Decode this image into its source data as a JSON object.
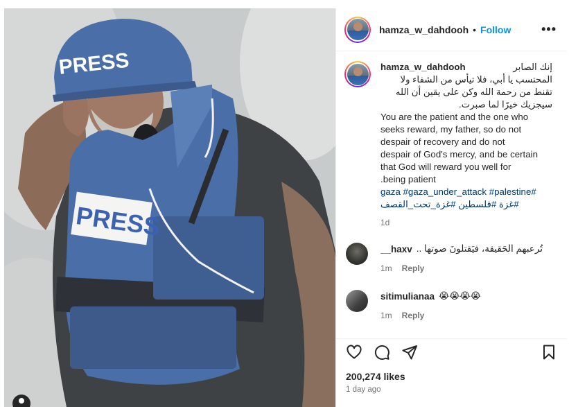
{
  "post": {
    "username": "hamza_w_dahdooh",
    "separator": "•",
    "follow_label": "Follow",
    "more_label": "•••",
    "photo": {
      "helmet_text": "PRESS",
      "vest_text": "PRESS"
    }
  },
  "caption": {
    "username": "hamza_w_dahdooh",
    "arabic_first": "إنك الصابر",
    "arabic_lines": [
      "المحتسب يا أبي، فلا تيأس من الشفاء ولا",
      "تقنط من رحمة الله وكن على يقين أن الله",
      "سيجزيك خيرًا لما صبرت."
    ],
    "english_lines": [
      "You are the patient and the one who",
      "seeks reward, my father, so do not",
      "despair of recovery and do not",
      "despair of God's mercy, and be certain",
      "that God will reward you well for",
      ".being patient"
    ],
    "hashtags_line1": "gaza #gaza_under_attack #palestine#",
    "hashtags_line2": "#غزة #فلسطين #غزة_تحت_القصف",
    "age": "1d"
  },
  "comments": [
    {
      "username": "__haxv",
      "text": "تُرعبهم الحَقيقة، فيَقتلونَ صوتها ..",
      "age": "1m",
      "reply_label": "Reply"
    },
    {
      "username": "sitimulianaa",
      "text": "😭😭😭😭",
      "age": "1m",
      "reply_label": "Reply"
    }
  ],
  "actions": {
    "icons": [
      "heart-icon",
      "comment-icon",
      "share-icon",
      "bookmark-icon"
    ],
    "likes": "200,274 likes",
    "posted": "1 day ago"
  },
  "colors": {
    "accent": "#0095f6",
    "hashtag": "#00376b",
    "muted": "#737373",
    "vest_blue": "#4a6ea8"
  }
}
